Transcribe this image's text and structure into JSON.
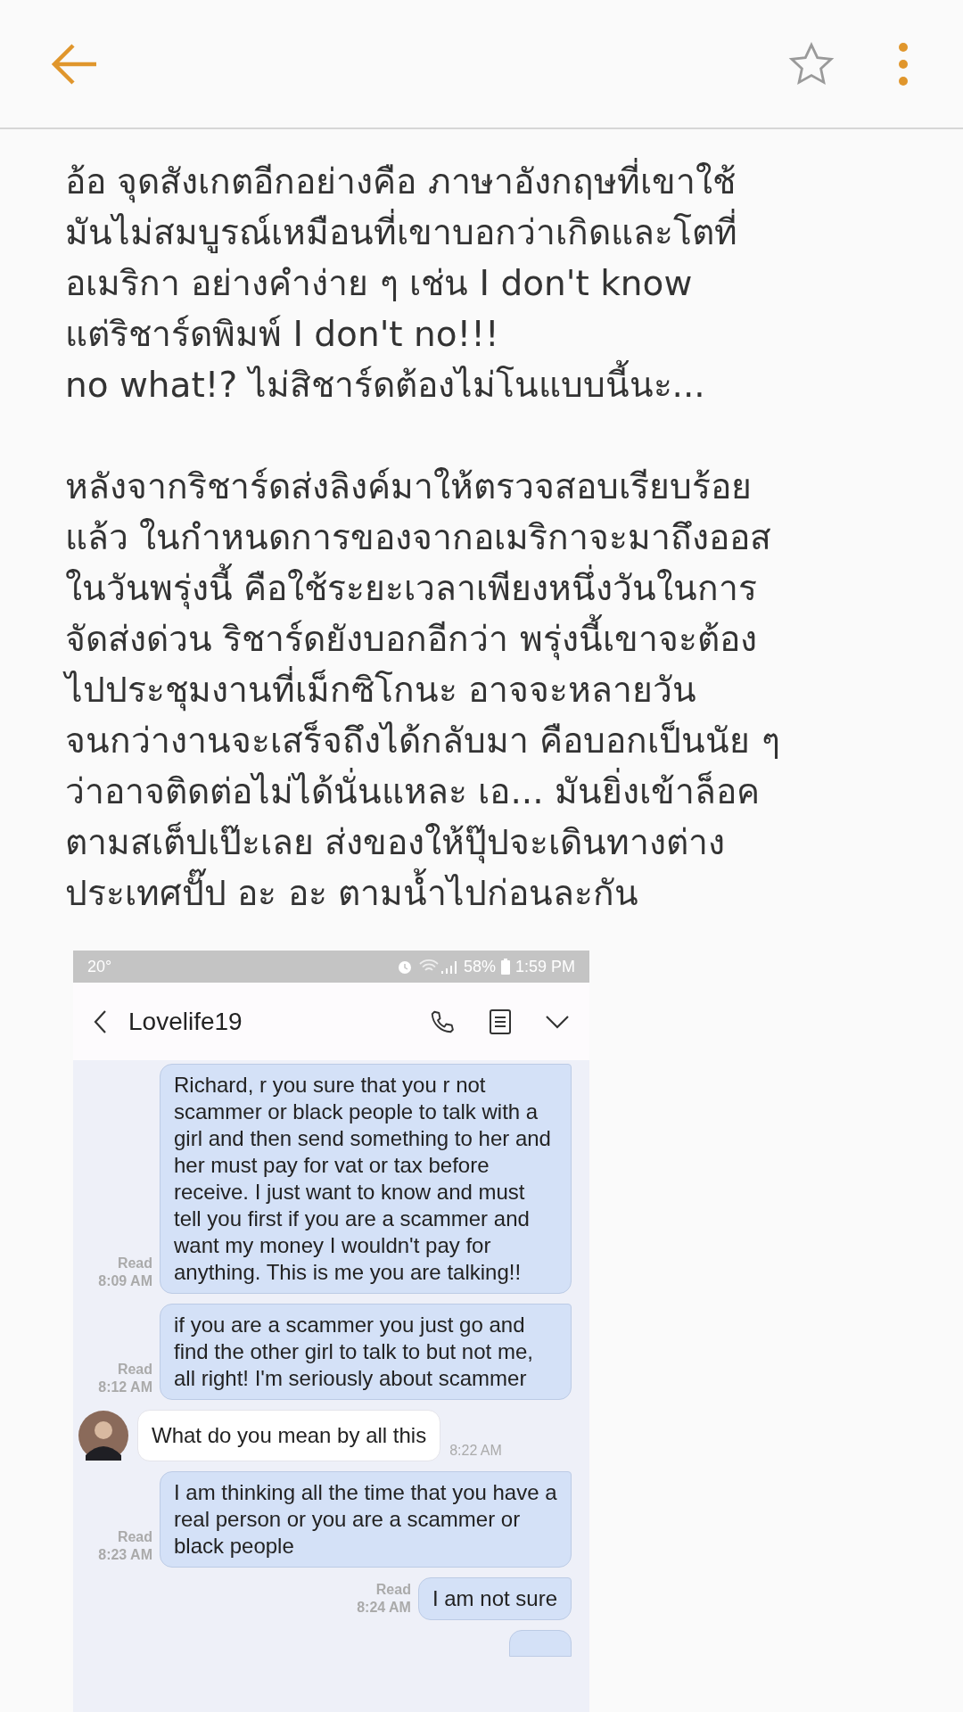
{
  "top_bar": {
    "starred": false
  },
  "article": {
    "paragraphs": [
      [
        "อ้อ จุดสังเกตอีกอย่างคือ ภาษาอังกฤษที่เขาใช้",
        "มันไม่สมบูรณ์เหมือนที่เขาบอกว่าเกิดและโตที่",
        "อเมริกา อย่างคำง่าย ๆ เช่น I don't know",
        "แต่ริชาร์ดพิมพ์ I don't no!!!",
        "no what!? ไม่สิชาร์ดต้องไม่โนแบบนี้นะ..."
      ],
      [
        "หลังจากริชาร์ดส่งลิงค์มาให้ตรวจสอบเรียบร้อย",
        "แล้ว ในกำหนดการของจากอเมริกาจะมาถึงออส",
        "ในวันพรุ่งนี้ คือใช้ระยะเวลาเพียงหนึ่งวันในการ",
        "จัดส่งด่วน ริชาร์ดยังบอกอีกว่า พรุ่งนี้เขาจะต้อง",
        "ไปประชุมงานที่เม็กซิโกนะ อาจจะหลายวัน",
        "จนกว่างานจะเสร็จถึงได้กลับมา คือบอกเป็นนัย ๆ",
        "ว่าอาจติดต่อไม่ได้นั่นแหละ เอ... มันยิ่งเข้าล็อค",
        "ตามสเต็ปเป๊ะเลย ส่งของให้ปุ๊ปจะเดินทางต่าง",
        "ประเทศปั๊ป อะ อะ ตามน้ำไปก่อนละกัน"
      ]
    ]
  },
  "screenshot": {
    "status_bar": {
      "temperature": "20°",
      "battery": "58%",
      "time": "1:59 PM"
    },
    "contact": "Lovelife19",
    "messages": [
      {
        "kind": "sent",
        "text": "Richard, r you sure that you r not scammer or black people to talk with a girl and then send something to her and her must pay for vat or tax before receive. I just want to know and must tell you first if you are a scammer and want my money I wouldn't pay for anything. This is me you are talking!!",
        "status": "Read",
        "time": "8:09 AM"
      },
      {
        "kind": "sent",
        "text": "if you are a scammer you just go and find the other girl to talk to but not me, all right! I'm seriously about scammer",
        "status": "Read",
        "time": "8:12 AM"
      },
      {
        "kind": "received",
        "text": "What do you mean by all this",
        "time": "8:22 AM"
      },
      {
        "kind": "sent",
        "text": "I am thinking all the time that you have a real person or you are a scammer or black people",
        "status": "Read",
        "time": "8:23 AM"
      },
      {
        "kind": "sent",
        "text": "I am not sure",
        "status": "Read",
        "time": "8:24 AM"
      },
      {
        "kind": "sent_cut"
      }
    ]
  }
}
